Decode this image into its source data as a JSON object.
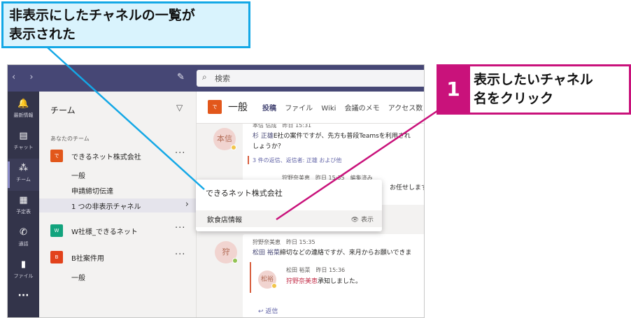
{
  "annotations": {
    "hidden_list": [
      "非表示にしたチャネルの一覧が",
      "表示された"
    ],
    "step_number": "1",
    "step_text": [
      "表示したいチャネル",
      "名をクリック"
    ]
  },
  "titlebar": {
    "nav_arrows": "‹  ›",
    "search_placeholder": "検索"
  },
  "appbar": {
    "items": [
      {
        "label": "最新情報",
        "icon": "bell-icon",
        "glyph": "🔔"
      },
      {
        "label": "チャット",
        "icon": "chat-icon",
        "glyph": "▤"
      },
      {
        "label": "チーム",
        "icon": "teams-icon",
        "glyph": "⁂"
      },
      {
        "label": "予定表",
        "icon": "calendar-icon",
        "glyph": "▦"
      },
      {
        "label": "通話",
        "icon": "phone-icon",
        "glyph": "✆"
      },
      {
        "label": "ファイル",
        "icon": "file-icon",
        "glyph": "▮"
      }
    ],
    "more": "···"
  },
  "teams_pane": {
    "title": "チーム",
    "section_label": "あなたのチーム",
    "teams": [
      {
        "name": "できるネット株式会社",
        "avatar_text": "で",
        "avatar_color": "#e2571b",
        "channels": [
          "一般",
          "申請締切伝達"
        ],
        "hidden_link": "1 つの非表示チャネル"
      },
      {
        "name": "W社様_できるネット",
        "avatar_text": "W",
        "avatar_color": "#12a37d",
        "channels": []
      },
      {
        "name": "B社案件用",
        "avatar_text": "B",
        "avatar_color": "#e2421b",
        "channels": [
          "一般"
        ]
      }
    ],
    "more": "···"
  },
  "channel_header": {
    "avatar_text": "で",
    "name": "一般",
    "tabs": [
      "投稿",
      "ファイル",
      "Wiki",
      "会議のメモ",
      "アクセス数"
    ]
  },
  "conversation": {
    "post1": {
      "avatar_text": "本信",
      "meta": "本信 信成　昨日 15:31",
      "line1_name": "杉 正雄",
      "line1_text": "E社の案件ですが、先方も普段Teamsを利用され",
      "line2": "しょうか？",
      "replies": "3 件の返信、返信者: 正雄 および他",
      "reply_meta": "狩野奈美恵　昨日 15:35　編集済み",
      "reply_text": "お任せします。"
    },
    "post2": {
      "avatar_text": "狩",
      "meta": "狩野奈美恵　昨日 15:35",
      "line1_name": "松田 裕菜",
      "line1_text": "締切などの連絡ですが、来月からお願いできま",
      "sub_avatar": "松裕",
      "sub_meta": "松田 裕菜　昨日 15:36",
      "sub_name": "狩野奈美恵",
      "sub_text": "承知しました。",
      "reply_label": "返信"
    }
  },
  "popup": {
    "team_name": "できるネット株式会社",
    "channel_name": "飲食店情報",
    "show_label": "表示"
  }
}
